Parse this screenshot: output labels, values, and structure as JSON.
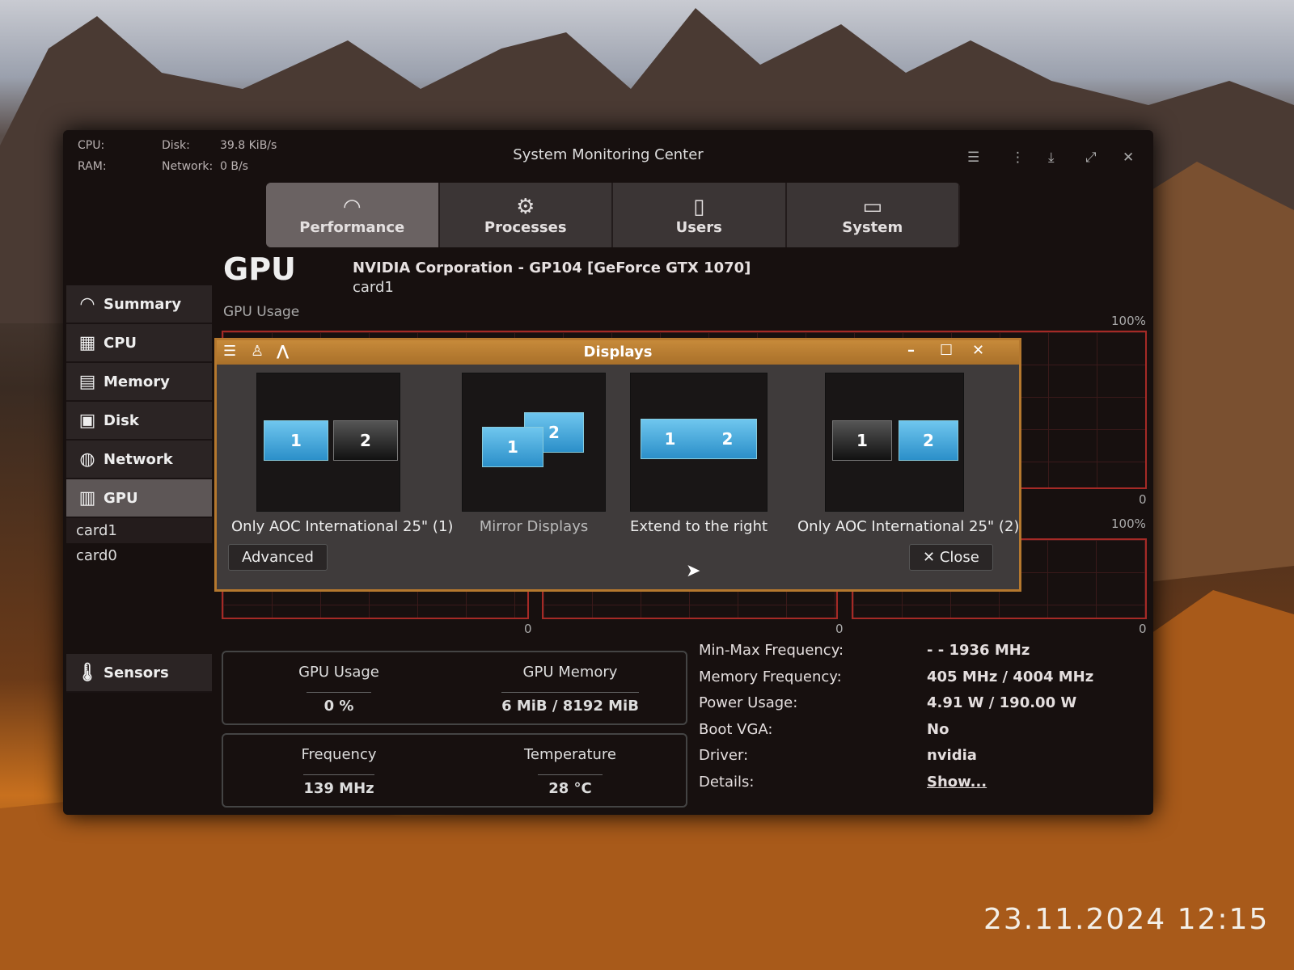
{
  "top_stats": {
    "cpu_label": "CPU:",
    "ram_label": "RAM:",
    "disk_label": "Disk:",
    "disk_value": "39.8 KiB/s",
    "network_label": "Network:",
    "network_value": "0 B/s"
  },
  "window": {
    "title": "System Monitoring Center"
  },
  "tabs": [
    {
      "label": "Performance",
      "icon": "gauge-icon"
    },
    {
      "label": "Processes",
      "icon": "gear-icon"
    },
    {
      "label": "Users",
      "icon": "mouse-icon"
    },
    {
      "label": "System",
      "icon": "monitor-icon"
    }
  ],
  "sidebar": {
    "items": [
      {
        "label": "Summary"
      },
      {
        "label": "CPU"
      },
      {
        "label": "Memory"
      },
      {
        "label": "Disk"
      },
      {
        "label": "Network"
      },
      {
        "label": "GPU"
      }
    ],
    "sub_items": [
      "card1",
      "card0"
    ],
    "sensors": "Sensors"
  },
  "gpu": {
    "heading": "GPU",
    "name": "NVIDIA Corporation - GP104 [GeForce GTX 1070]",
    "card": "card1",
    "usage_label": "GPU Usage",
    "max_label": "100%",
    "min_label": "0"
  },
  "summary": {
    "usage_label": "GPU Usage",
    "usage_value": "0 %",
    "memory_label": "GPU Memory",
    "memory_value": "6 MiB / 8192 MiB",
    "frequency_label": "Frequency",
    "frequency_value": "139 MHz",
    "temp_label": "Temperature",
    "temp_value": "28 °C"
  },
  "info": [
    {
      "k": "Min-Max Frequency:",
      "v": "- - 1936 MHz"
    },
    {
      "k": "Memory Frequency:",
      "v": "405 MHz / 4004 MHz"
    },
    {
      "k": "Power Usage:",
      "v": "4.91 W / 190.00 W"
    },
    {
      "k": "Boot VGA:",
      "v": "No"
    },
    {
      "k": "Driver:",
      "v": "nvidia"
    },
    {
      "k": "Details:",
      "v": "Show..."
    }
  ],
  "dialog": {
    "title": "Displays",
    "options": [
      "Only AOC International 25\" (1)",
      "Mirror Displays",
      "Extend to the right",
      "Only AOC International 25\" (2)"
    ],
    "advanced": "Advanced",
    "close": "Close",
    "m1": "1",
    "m2": "2"
  },
  "photo_timestamp": "23.11.2024 12:15"
}
